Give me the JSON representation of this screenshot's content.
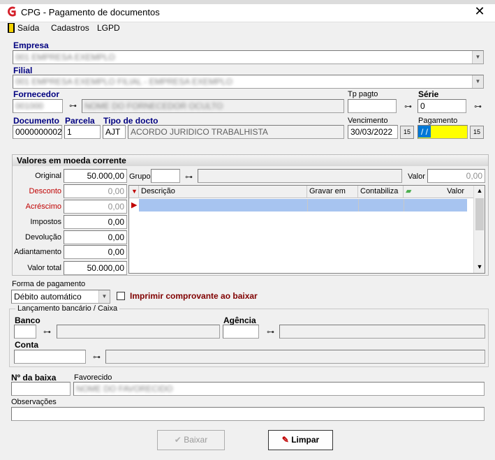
{
  "window": {
    "title": "CPG - Pagamento de documentos",
    "close_glyph": "✕"
  },
  "menu": [
    "Saída",
    "Cadastros",
    "LGPD"
  ],
  "empresa": {
    "label": "Empresa",
    "value": "001 EMPRESA EXEMPLO"
  },
  "filial": {
    "label": "Filial",
    "value": "001 EMPRESA EXEMPLO FILIAL - EMPRESA EXEMPLO"
  },
  "fornecedor": {
    "label": "Fornecedor",
    "code": "001000",
    "name": "NOME DO FORNECEDOR OCULTO"
  },
  "tp_pagto": {
    "label": "Tp pagto",
    "value": ""
  },
  "serie": {
    "label": "Série",
    "value": "0"
  },
  "documento": {
    "label": "Documento",
    "value": "0000000002"
  },
  "parcela": {
    "label": "Parcela",
    "value": "1"
  },
  "tipo_docto": {
    "label": "Tipo de docto",
    "code": "AJT",
    "desc": "ACORDO JURIDICO TRABALHISTA"
  },
  "vencimento": {
    "label": "Vencimento",
    "value": "30/03/2022"
  },
  "pagamento": {
    "label": "Pagamento",
    "value": " / /"
  },
  "valores": {
    "title": "Valores em moeda corrente",
    "rows": [
      {
        "label": "Original",
        "value": "50.000,00"
      },
      {
        "label": "Desconto",
        "value": "0,00"
      },
      {
        "label": "Acréscimo",
        "value": "0,00"
      },
      {
        "label": "Impostos",
        "value": "0,00"
      },
      {
        "label": "Devolução",
        "value": "0,00"
      },
      {
        "label": "Adiantamento",
        "value": "0,00"
      },
      {
        "label": "Valor total",
        "value": "50.000,00"
      }
    ],
    "grupo_label": "Grupo",
    "valor_label": "Valor",
    "valor_value": "0,00",
    "grid_headers": [
      "Descrição",
      "Gravar em",
      "Contabiliza",
      "Valor"
    ]
  },
  "forma_pagamento": {
    "label": "Forma de pagamento",
    "value": "Débito automático"
  },
  "imprimir": {
    "label": "Imprimir comprovante ao baixar",
    "checked": false
  },
  "lancamento": {
    "title": "Lançamento bancário / Caixa",
    "banco_label": "Banco",
    "agencia_label": "Agência",
    "conta_label": "Conta"
  },
  "baixa": {
    "label": "Nº da baixa",
    "value": ""
  },
  "favorecido": {
    "label": "Favorecido",
    "value": "NOME DO FAVORECIDO"
  },
  "observacoes": {
    "label": "Observações",
    "value": ""
  },
  "buttons": {
    "baixar": "Baixar",
    "limpar": "Limpar"
  },
  "colors": {
    "accent_yellow": "#ffff00",
    "selection_blue": "#0078d7",
    "label_blue": "#000080",
    "red_label": "#c00000"
  }
}
